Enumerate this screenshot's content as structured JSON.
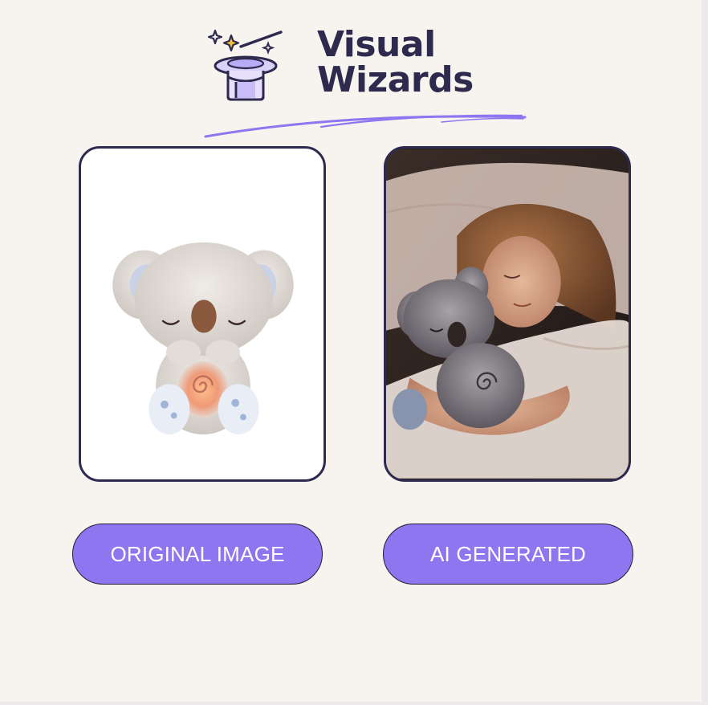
{
  "brand": {
    "line1": "Visual",
    "line2": "Wizards",
    "icon": "magic-hat-wand-icon",
    "text_color": "#2e2a4e",
    "accent_color": "#8e76f0"
  },
  "images": {
    "original": {
      "icon": "koala-plush-image"
    },
    "ai_generated": {
      "icon": "woman-sleeping-with-koala-plush-image"
    }
  },
  "buttons": {
    "original_label": "ORIGINAL IMAGE",
    "ai_label": "AI GENERATED",
    "color": "#8e76f0"
  },
  "colors": {
    "background": "#f7f4f0",
    "card_border": "#2f2a4f"
  }
}
